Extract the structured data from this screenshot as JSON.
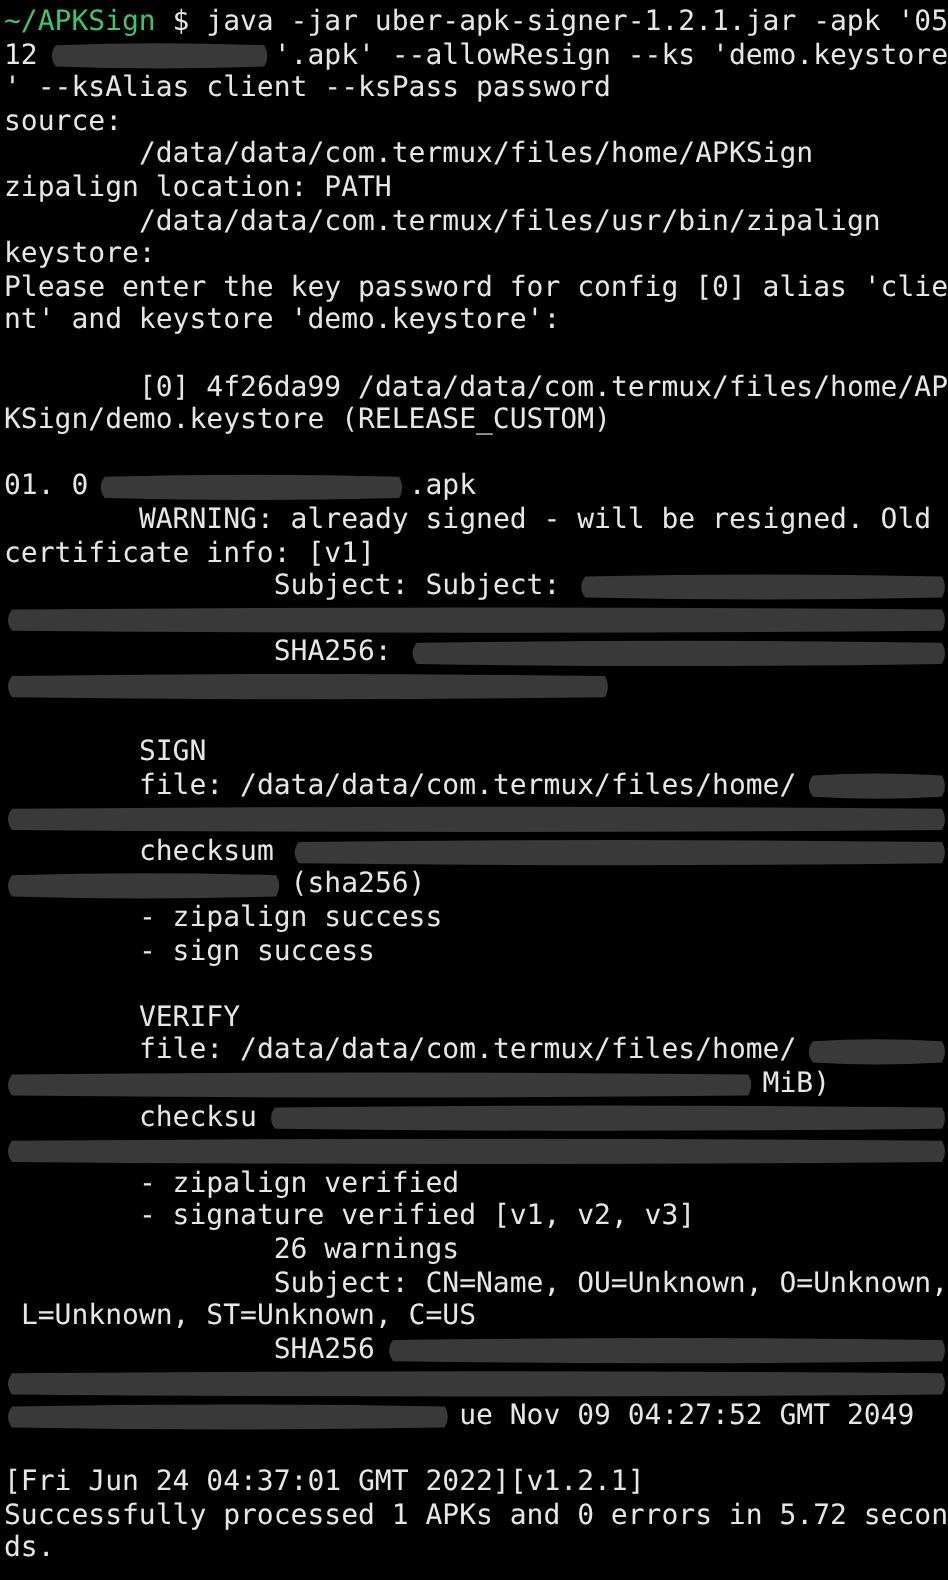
{
  "terminal": {
    "lines": [
      {
        "kind": "prompt",
        "path": "~/APKSign",
        "text": " $ java -jar uber-apk-signer-1.2.1.jar -apk '05"
      },
      {
        "kind": "output",
        "segments": [
          "12",
          "              '.apk' --allowResign --ks 'demo.keystore"
        ]
      },
      {
        "kind": "output",
        "segments": [
          "' --ksAlias client --ksPass password"
        ]
      },
      {
        "kind": "output",
        "segments": [
          "source:"
        ]
      },
      {
        "kind": "output",
        "segments": [
          "        /data/data/com.termux/files/home/APKSign"
        ]
      },
      {
        "kind": "output",
        "segments": [
          "zipalign location: PATH"
        ]
      },
      {
        "kind": "output",
        "segments": [
          "        /data/data/com.termux/files/usr/bin/zipalign"
        ]
      },
      {
        "kind": "output",
        "segments": [
          "keystore:"
        ]
      },
      {
        "kind": "output",
        "segments": [
          "Please enter the key password for config [0] alias 'clie"
        ]
      },
      {
        "kind": "output",
        "segments": [
          "nt' and keystore 'demo.keystore':"
        ]
      },
      {
        "kind": "blank"
      },
      {
        "kind": "output",
        "segments": [
          "        [0] 4f26da99 /data/data/com.termux/files/home/AP"
        ]
      },
      {
        "kind": "output",
        "segments": [
          "KSign/demo.keystore (RELEASE_CUSTOM)"
        ]
      },
      {
        "kind": "blank"
      },
      {
        "kind": "output",
        "segments": [
          "01. 0",
          "                   .apk"
        ]
      },
      {
        "kind": "output",
        "segments": [
          "        WARNING: already signed - will be resigned. Old"
        ]
      },
      {
        "kind": "output",
        "segments": [
          "certificate info: [v1]"
        ]
      },
      {
        "kind": "output",
        "segments": [
          "                Subject: Subject:"
        ]
      },
      {
        "kind": "blank"
      },
      {
        "kind": "output",
        "segments": [
          "                SHA256:"
        ]
      },
      {
        "kind": "blank"
      },
      {
        "kind": "blank"
      },
      {
        "kind": "output",
        "segments": [
          "        SIGN"
        ]
      },
      {
        "kind": "output",
        "segments": [
          "        file: /data/data/com.termux/files/home/"
        ]
      },
      {
        "kind": "blank"
      },
      {
        "kind": "output",
        "segments": [
          "        checksum"
        ]
      },
      {
        "kind": "output",
        "segments": [
          "                 (sha256)"
        ]
      },
      {
        "kind": "output",
        "segments": [
          "        - zipalign success"
        ]
      },
      {
        "kind": "output",
        "segments": [
          "        - sign success"
        ]
      },
      {
        "kind": "blank"
      },
      {
        "kind": "output",
        "segments": [
          "        VERIFY"
        ]
      },
      {
        "kind": "output",
        "segments": [
          "        file: /data/data/com.termux/files/home/"
        ]
      },
      {
        "kind": "output",
        "segments": [
          "                                             MiB)"
        ]
      },
      {
        "kind": "output",
        "segments": [
          "        checksu"
        ]
      },
      {
        "kind": "blank"
      },
      {
        "kind": "output",
        "segments": [
          "        - zipalign verified"
        ]
      },
      {
        "kind": "output",
        "segments": [
          "        - signature verified [v1, v2, v3]"
        ]
      },
      {
        "kind": "output",
        "segments": [
          "                26 warnings"
        ]
      },
      {
        "kind": "output",
        "segments": [
          "                Subject: CN=Name, OU=Unknown, O=Unknown,"
        ]
      },
      {
        "kind": "output",
        "segments": [
          " L=Unknown, ST=Unknown, C=US"
        ]
      },
      {
        "kind": "output",
        "segments": [
          "                SHA256"
        ]
      },
      {
        "kind": "blank"
      },
      {
        "kind": "output",
        "segments": [
          "                           ue Nov 09 04:27:52 GMT 2049"
        ]
      },
      {
        "kind": "blank"
      },
      {
        "kind": "output",
        "segments": [
          "[Fri Jun 24 04:37:01 GMT 2022][v1.2.1]"
        ]
      },
      {
        "kind": "output",
        "segments": [
          "Successfully processed 1 APKs and 0 errors in 5.72 secon"
        ]
      },
      {
        "kind": "output",
        "segments": [
          "ds."
        ]
      }
    ]
  }
}
